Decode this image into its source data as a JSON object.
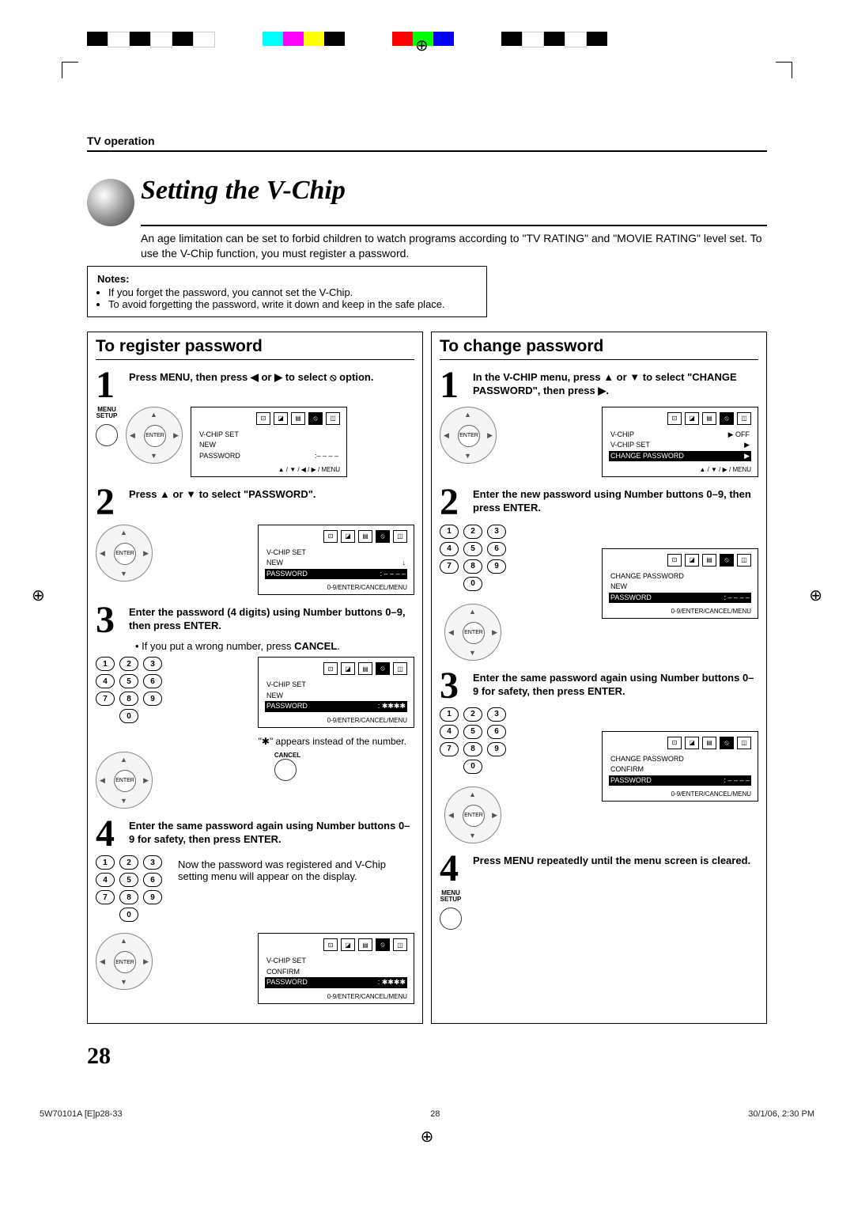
{
  "header": {
    "tv_operation": "TV operation"
  },
  "title": "Setting the V-Chip",
  "intro": "An age limitation can be set to forbid children to watch programs according to \"TV RATING\" and \"MOVIE RATING\" level set. To use the V-Chip function, you must register a password.",
  "notes": {
    "heading": "Notes:",
    "items": [
      "If you forget the password, you cannot set the V-Chip.",
      "To avoid forgetting the password, write it down and keep in the safe place."
    ]
  },
  "left": {
    "heading": "To register password",
    "s1": "Press MENU, then press ◀ or ▶ to select ⦸ option.",
    "s2": "Press ▲ or ▼ to select \"PASSWORD\".",
    "s3": "Enter the password (4 digits) using Number buttons 0–9, then press ENTER.",
    "s3_note1": "If you put a wrong number, press",
    "s3_cancel": "CANCEL",
    "s3_note2": "\"✱\" appears instead of the number.",
    "s4": "Enter the same password again using Number buttons 0–9 for safety, then press ENTER.",
    "s4_note": "Now the password was registered and V-Chip setting menu will appear on the display."
  },
  "right": {
    "heading": "To change password",
    "s1": "In the V-CHIP menu, press ▲ or ▼ to select \"CHANGE PASSWORD\", then press ▶.",
    "s2": "Enter the new password using Number buttons 0–9, then press ENTER.",
    "s3": "Enter the same password again using Number buttons 0–9 for safety, then press ENTER.",
    "s4": "Press MENU repeatedly until the menu screen is cleared."
  },
  "osd": {
    "l1": {
      "row1": "V-CHIP SET",
      "row2l": "NEW",
      "row2r": "",
      "row3l": "PASSWORD",
      "row3r": ":– – – –",
      "foot": "▲ / ▼ / ◀ / ▶ / MENU"
    },
    "l2": {
      "row1": "V-CHIP SET",
      "row2l": "NEW",
      "row3l": "PASSWORD",
      "row3r": ": – – – –",
      "foot": "0-9/ENTER/CANCEL/MENU"
    },
    "l3": {
      "row1": "V-CHIP SET",
      "row2l": "NEW",
      "row3l": "PASSWORD",
      "row3r": ": ✱✱✱✱",
      "foot": "0-9/ENTER/CANCEL/MENU"
    },
    "l4": {
      "row1": "V-CHIP SET",
      "row2l": "CONFIRM",
      "row3l": "PASSWORD",
      "row3r": ": ✱✱✱✱",
      "foot": "0-9/ENTER/CANCEL/MENU"
    },
    "r1": {
      "rows": [
        {
          "l": "V-CHIP",
          "r": "▶ OFF"
        },
        {
          "l": "V-CHIP SET",
          "r": "▶"
        },
        {
          "l": "CHANGE PASSWORD",
          "r": "▶",
          "hl": true
        }
      ],
      "foot": "▲ / ▼ / ▶ / MENU"
    },
    "r2": {
      "row1": "CHANGE  PASSWORD",
      "row2l": "NEW",
      "row3l": "PASSWORD",
      "row3r": ": – – – –",
      "foot": "0-9/ENTER/CANCEL/MENU"
    },
    "r3": {
      "row1": "CHANGE  PASSWORD",
      "row2l": "CONFIRM",
      "row3l": "PASSWORD",
      "row3r": ": – – – –",
      "foot": "0-9/ENTER/CANCEL/MENU"
    }
  },
  "labels": {
    "enter": "ENTER",
    "menu": "MENU",
    "setup": "SETUP",
    "cancel": "CANCEL"
  },
  "keypad": [
    "1",
    "2",
    "3",
    "4",
    "5",
    "6",
    "7",
    "8",
    "9",
    "0"
  ],
  "page_number": "28",
  "footer": {
    "left": "5W70101A [E]p28-33",
    "center": "28",
    "right": "30/1/06, 2:30 PM"
  }
}
